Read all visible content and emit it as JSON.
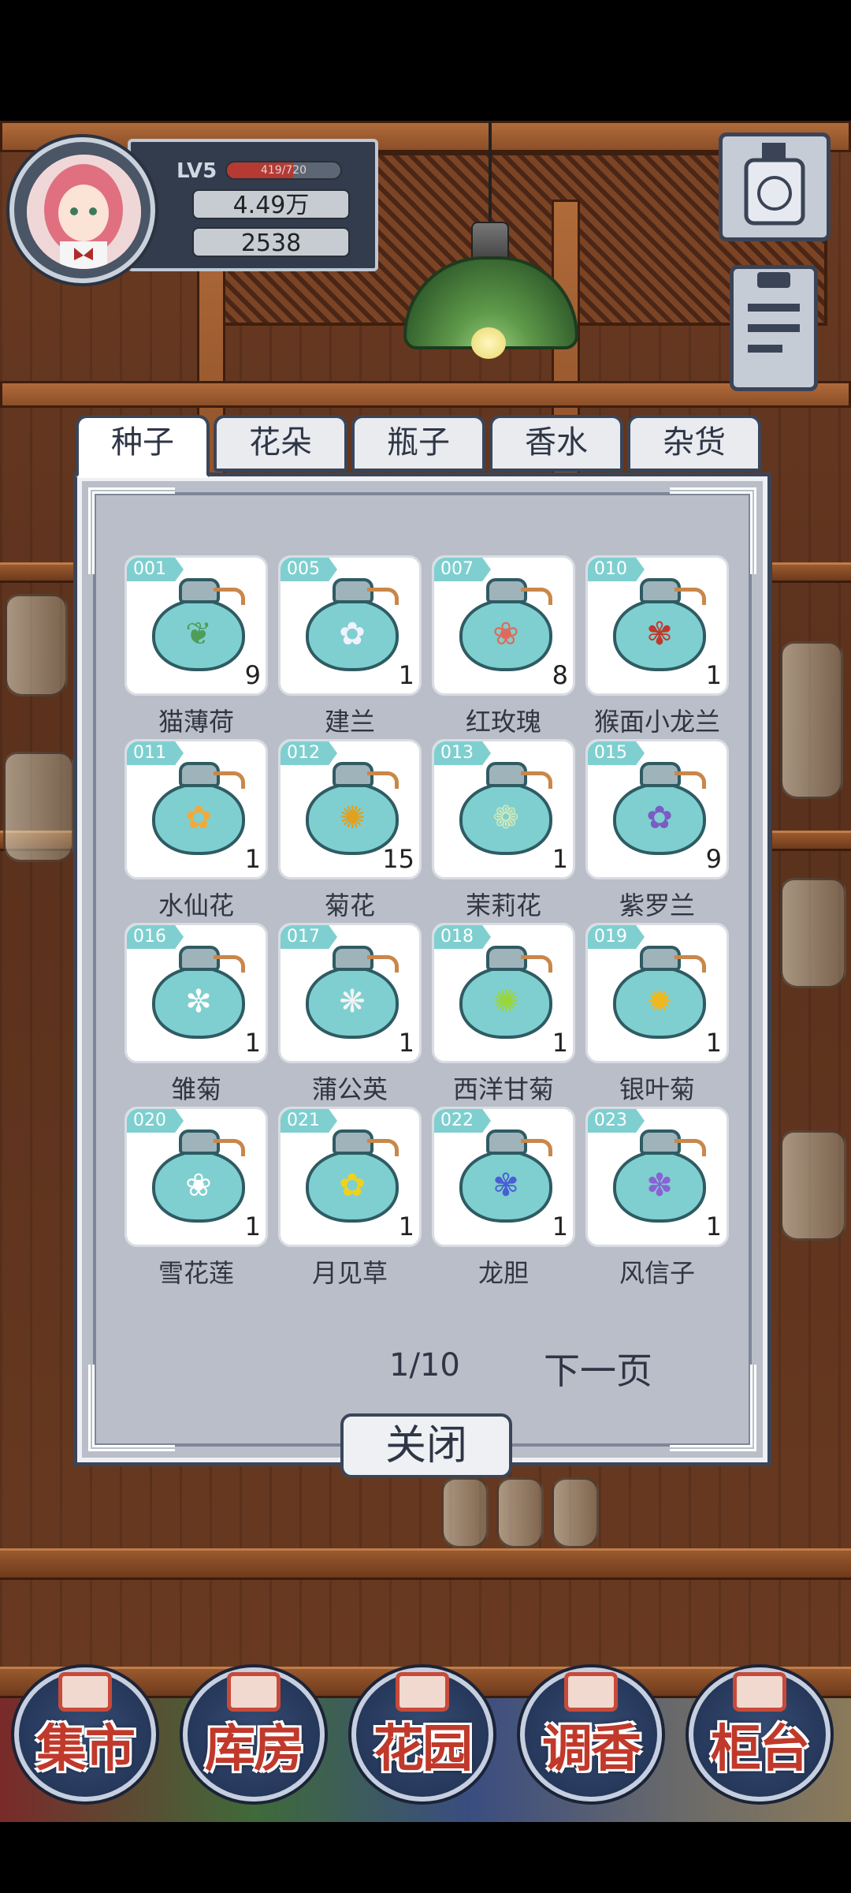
{
  "hud": {
    "level": "LV5",
    "xp_text": "419/720",
    "xp_fraction": 0.58,
    "money": "4.49万",
    "petals": "2538",
    "money_icon": "petal-coin-icon",
    "petals_icon": "leaf-icon"
  },
  "tabs": [
    "种子",
    "花朵",
    "瓶子",
    "香水",
    "杂货"
  ],
  "active_tab": 0,
  "items": [
    {
      "id": "001",
      "name": "猫薄荷",
      "count": "9",
      "flower": "❦",
      "color": "#4f9d5a"
    },
    {
      "id": "005",
      "name": "建兰",
      "count": "1",
      "flower": "✿",
      "color": "#f2f2ff"
    },
    {
      "id": "007",
      "name": "红玫瑰",
      "count": "8",
      "flower": "❀",
      "color": "#e06a5a"
    },
    {
      "id": "010",
      "name": "猴面小龙兰",
      "count": "1",
      "flower": "✾",
      "color": "#c0392b"
    },
    {
      "id": "011",
      "name": "水仙花",
      "count": "1",
      "flower": "✿",
      "color": "#f2a93b"
    },
    {
      "id": "012",
      "name": "菊花",
      "count": "15",
      "flower": "✺",
      "color": "#e0a020"
    },
    {
      "id": "013",
      "name": "茉莉花",
      "count": "1",
      "flower": "❁",
      "color": "#cfe9b8"
    },
    {
      "id": "015",
      "name": "紫罗兰",
      "count": "9",
      "flower": "✿",
      "color": "#7a5cc4"
    },
    {
      "id": "016",
      "name": "雏菊",
      "count": "1",
      "flower": "✼",
      "color": "#ffffff"
    },
    {
      "id": "017",
      "name": "蒲公英",
      "count": "1",
      "flower": "❋",
      "color": "#f4f4f4"
    },
    {
      "id": "018",
      "name": "西洋甘菊",
      "count": "1",
      "flower": "✺",
      "color": "#9ad63a"
    },
    {
      "id": "019",
      "name": "银叶菊",
      "count": "1",
      "flower": "✹",
      "color": "#f0b820"
    },
    {
      "id": "020",
      "name": "雪花莲",
      "count": "1",
      "flower": "❀",
      "color": "#ffffff"
    },
    {
      "id": "021",
      "name": "月见草",
      "count": "1",
      "flower": "✿",
      "color": "#f0d21c"
    },
    {
      "id": "022",
      "name": "龙胆",
      "count": "1",
      "flower": "✾",
      "color": "#4b5ed4"
    },
    {
      "id": "023",
      "name": "风信子",
      "count": "1",
      "flower": "✽",
      "color": "#8a62d4"
    }
  ],
  "pager": {
    "page": "1/10",
    "next_label": "下一页"
  },
  "close_label": "关闭",
  "bottom_nav": [
    {
      "label": "集市",
      "icon": "market-icon"
    },
    {
      "label": "库房",
      "icon": "storehouse-icon"
    },
    {
      "label": "花园",
      "icon": "rose-icon"
    },
    {
      "label": "调香",
      "icon": "perfume-icon"
    },
    {
      "label": "柜台",
      "icon": "counter-icon"
    }
  ],
  "side_icons": [
    "perfume-bottle-icon",
    "clipboard-icon"
  ]
}
